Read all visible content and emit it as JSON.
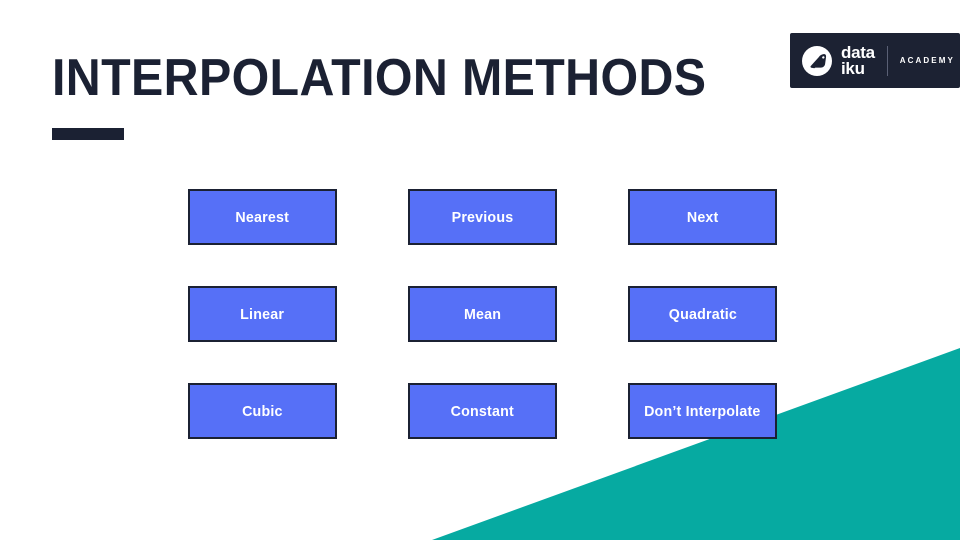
{
  "slide": {
    "title": "INTERPOLATION METHODS",
    "background_color": "#FFFFFF",
    "accent_navy": "#1B2133",
    "accent_teal": "#06AAA1",
    "accent_blue": "#5670F7"
  },
  "logo": {
    "brand_line1": "data",
    "brand_line2": "iku",
    "sub_label": "ACADEMY",
    "mark_icon": "dataiku-bird-icon",
    "background_color": "#1C2233"
  },
  "methods": [
    {
      "label": "Nearest"
    },
    {
      "label": "Previous"
    },
    {
      "label": "Next"
    },
    {
      "label": "Linear"
    },
    {
      "label": "Mean"
    },
    {
      "label": "Quadratic"
    },
    {
      "label": "Cubic"
    },
    {
      "label": "Constant"
    },
    {
      "label": "Don’t Interpolate"
    }
  ]
}
